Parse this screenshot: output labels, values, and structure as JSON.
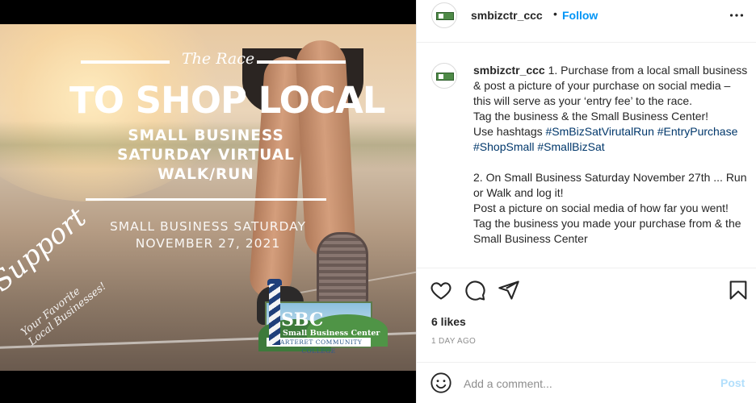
{
  "post_image": {
    "script_title": "The Race",
    "headline": "TO SHOP LOCAL",
    "subheadline_lines": [
      "SMALL BUSINESS",
      "SATURDAY VIRTUAL",
      "WALK/RUN"
    ],
    "date_lines": [
      "SMALL BUSINESS SATURDAY",
      "NOVEMBER 27, 2021"
    ],
    "support_script": "Support",
    "support_sub_lines": [
      "Your Favorite",
      "Local Businesses!"
    ],
    "logo": {
      "initials": "SBC",
      "name": "Small Business Center",
      "college": "CARTERET COMMUNITY COLLEGE"
    }
  },
  "header": {
    "username": "smbizctr_ccc",
    "separator": "•",
    "follow_label": "Follow",
    "more_icon": "more-horizontal-icon"
  },
  "caption": {
    "username": "smbizctr_ccc",
    "line1_text": " 1. Purchase from a local small business & post a picture of your purchase on social media – this will serve as your ‘entry fee’ to the race.",
    "line2_text": "Tag the business & the Small Business Center!",
    "line3_prefix": "Use hashtags ",
    "hashtags": [
      "#SmBizSatVirutalRun",
      "#EntryPurchase",
      "#ShopSmall",
      "#SmallBizSat"
    ],
    "line4_text": "2. On Small Business Saturday November 27th ... Run or Walk and log it!",
    "line5_text": "Post a picture on social media of how far you went!",
    "line6_text": "Tag the business you made your purchase from & the Small Business Center"
  },
  "actions": {
    "like_icon": "heart-icon",
    "comment_icon": "comment-icon",
    "share_icon": "share-icon",
    "save_icon": "bookmark-icon"
  },
  "likes_label": "6 likes",
  "post_time": "1 DAY AGO",
  "comment_box": {
    "emoji_icon": "emoji-icon",
    "placeholder": "Add a comment...",
    "post_label": "Post"
  },
  "colors": {
    "link_blue": "#0095f6",
    "hashtag_blue": "#00376b",
    "post_disabled": "#b2dffc",
    "text": "#262626",
    "muted": "#8e8e8e"
  }
}
